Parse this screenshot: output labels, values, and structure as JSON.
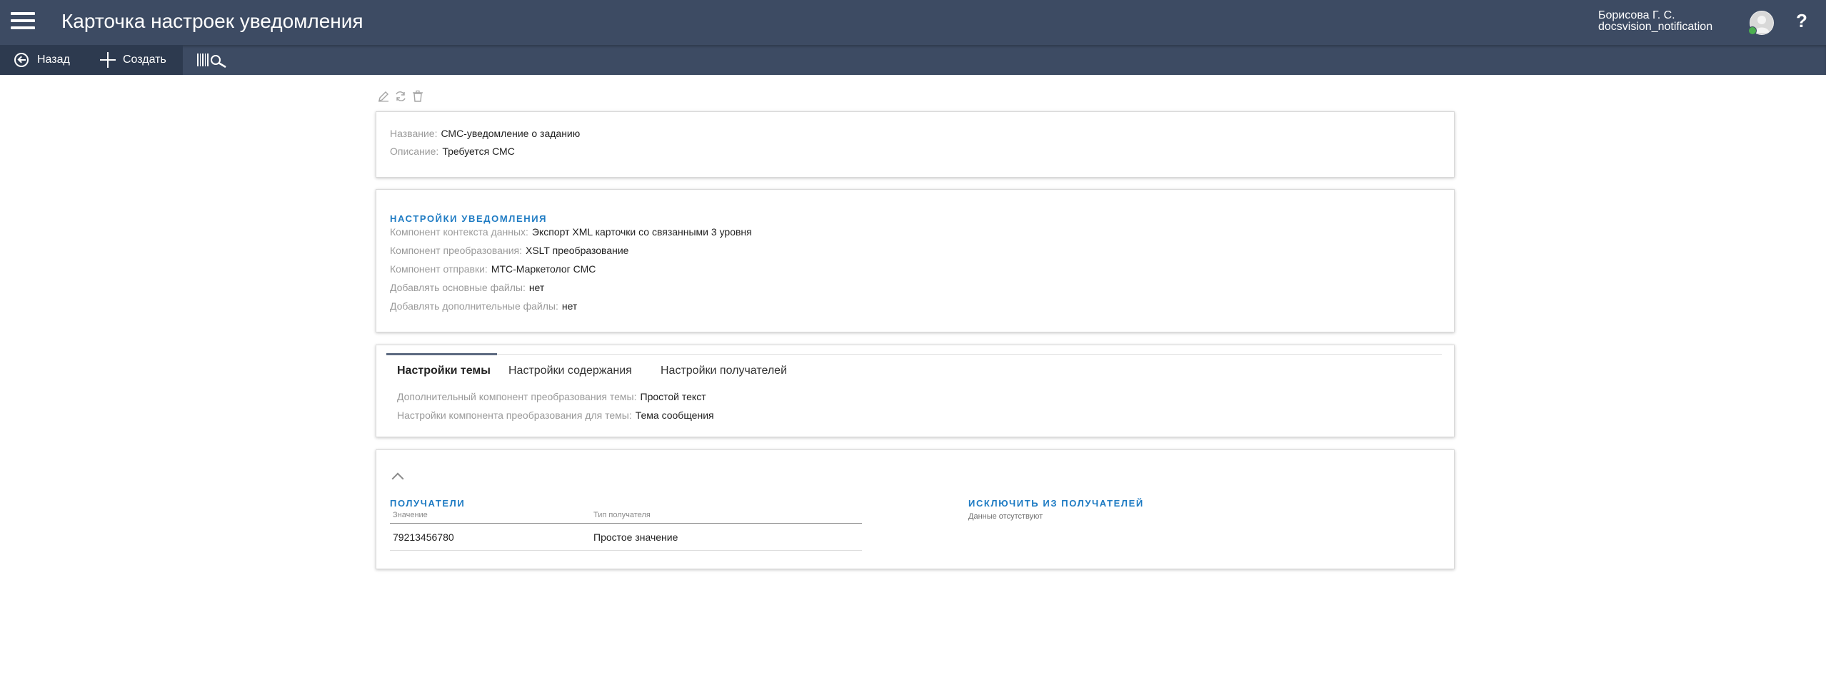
{
  "header": {
    "title": "Карточка настроек уведомления",
    "user_name": "Борисова Г. С.",
    "user_login": "docsvision_notification",
    "help": "?"
  },
  "toolbar": {
    "back_label": "Назад",
    "create_label": "Создать"
  },
  "general": {
    "name_label": "Название:",
    "name_value": "СМС-уведомление о заданию",
    "description_label": "Описание:",
    "description_value": "Требуется СМС"
  },
  "notification_settings": {
    "title": "НАСТРОЙКИ УВЕДОМЛЕНИЯ",
    "fields": [
      {
        "label": "Компонент контекста данных:",
        "value": "Экспорт XML карточки со связанными 3 уровня"
      },
      {
        "label": "Компонент преобразования:",
        "value": "XSLT преобразование"
      },
      {
        "label": "Компонент отправки:",
        "value": "МТС-Маркетолог СМС"
      },
      {
        "label": "Добавлять основные файлы:",
        "value": "нет"
      },
      {
        "label": "Добавлять дополнительные файлы:",
        "value": "нет"
      }
    ]
  },
  "tabs": {
    "items": [
      {
        "label": "Настройки темы",
        "active": true
      },
      {
        "label": "Настройки содержания",
        "active": false
      },
      {
        "label": "Настройки получателей",
        "active": false
      }
    ],
    "fields": [
      {
        "label": "Дополнительный компонент преобразования темы:",
        "value": "Простой текст"
      },
      {
        "label": "Настройки компонента преобразования для темы:",
        "value": "Тема сообщения"
      }
    ]
  },
  "recipients": {
    "title": "ПОЛУЧАТЕЛИ",
    "columns": [
      "Значение",
      "Тип получателя"
    ],
    "rows": [
      {
        "value": "79213456780",
        "type": "Простое значение"
      }
    ],
    "exclude_title": "ИСКЛЮЧИТЬ ИЗ ПОЛУЧАТЕЛЕЙ",
    "exclude_empty": "Данные отсутствуют"
  }
}
